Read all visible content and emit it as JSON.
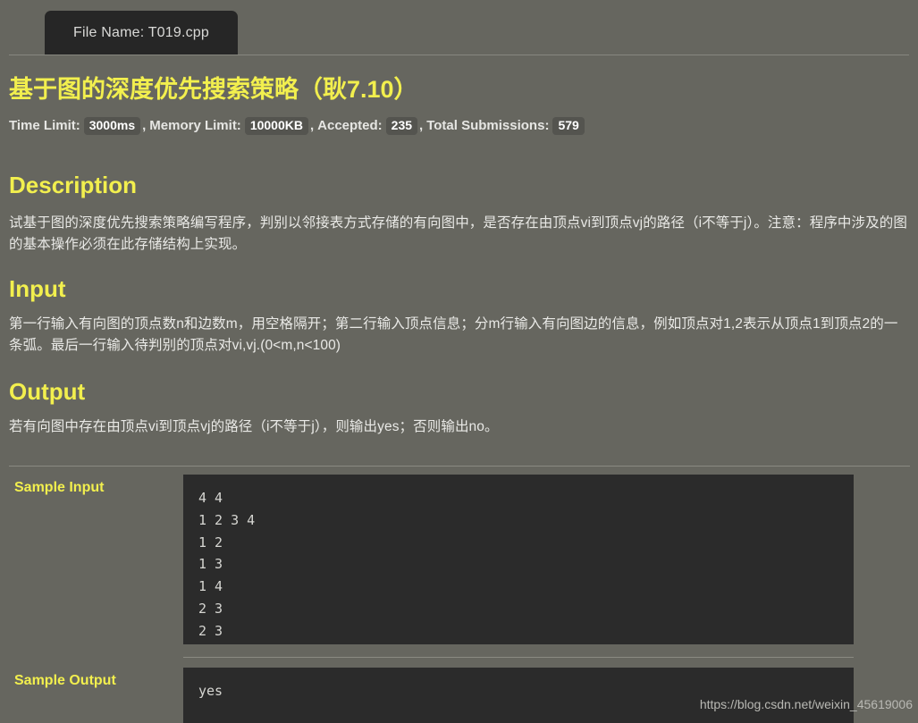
{
  "page": {
    "background_color": "#66665f",
    "accent_color": "#f2ef4e",
    "code_bg_color": "#2b2b2b"
  },
  "tab": {
    "label": "File Name: T019.cpp"
  },
  "problem": {
    "title": "基于图的深度优先搜索策略（耿7.10）",
    "stats": {
      "time_limit_label": "Time Limit:",
      "time_limit_value": "3000ms",
      "memory_limit_label": "Memory Limit:",
      "memory_limit_value": "10000KB",
      "accepted_label": ", Accepted:",
      "accepted_value": "235",
      "submissions_label": ", Total Submissions:",
      "submissions_value": "579",
      "comma_1": ",",
      "comma_2": ","
    }
  },
  "sections": {
    "description": {
      "heading": "Description",
      "body": "试基于图的深度优先搜索策略编写程序，判别以邻接表方式存储的有向图中，是否存在由顶点vi到顶点vj的路径（i不等于j）。注意：程序中涉及的图的基本操作必须在此存储结构上实现。"
    },
    "input": {
      "heading": "Input",
      "body": "第一行输入有向图的顶点数n和边数m，用空格隔开；第二行输入顶点信息；分m行输入有向图边的信息，例如顶点对1,2表示从顶点1到顶点2的一条弧。最后一行输入待判别的顶点对vi,vj.(0<m,n<100)"
    },
    "output": {
      "heading": "Output",
      "body": "若有向图中存在由顶点vi到顶点vj的路径（i不等于j），则输出yes；否则输出no。"
    }
  },
  "samples": {
    "input_label": "Sample Input",
    "input_text": "4 4\n1 2 3 4\n1 2\n1 3\n1 4\n2 3\n2 3",
    "output_label": "Sample Output",
    "output_text": "yes"
  },
  "watermark": {
    "text": "https://blog.csdn.net/weixin_45619006"
  }
}
